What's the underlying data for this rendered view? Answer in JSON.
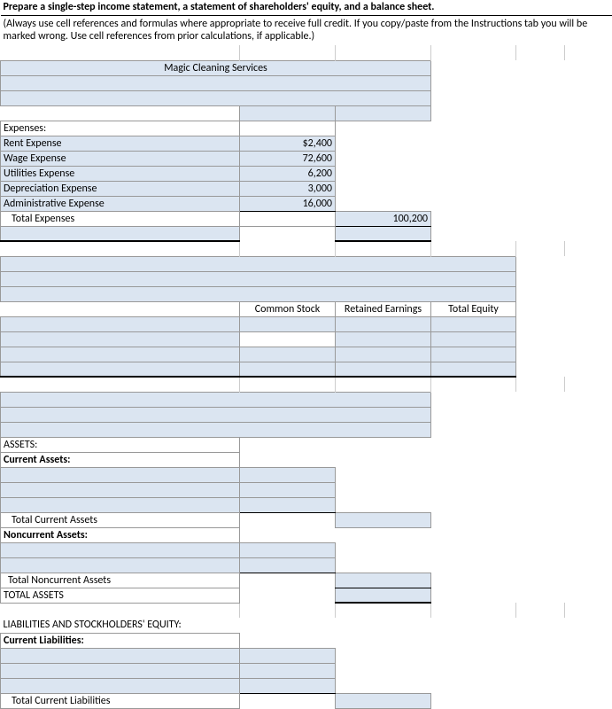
{
  "header": {
    "title": "Prepare a single-step income statement, a statement of shareholders' equity, and a balance sheet.",
    "note": "(Always use cell references and formulas where appropriate to receive full credit. If you copy/paste from the Instructions tab you will be marked wrong. Use cell references from prior calculations, if applicable.)"
  },
  "company": "Magic Cleaning Services",
  "income": {
    "section": "Expenses:",
    "items": [
      {
        "label": "Rent Expense",
        "value": "$2,400"
      },
      {
        "label": "Wage Expense",
        "value": "72,600"
      },
      {
        "label": "Utilities Expense",
        "value": "6,200"
      },
      {
        "label": "Depreciation Expense",
        "value": "3,000"
      },
      {
        "label": "Administrative Expense",
        "value": "16,000"
      }
    ],
    "total_label": "Total Expenses",
    "total_value": "100,200"
  },
  "equity": {
    "col1": "Common Stock",
    "col2": "Retained Earnings",
    "col3": "Total Equity"
  },
  "balance": {
    "assets": "ASSETS:",
    "current_assets": "Current Assets:",
    "total_current_assets": "Total Current Assets",
    "noncurrent_assets": "Noncurrent Assets:",
    "total_noncurrent_assets": "Total Noncurrent Assets",
    "total_assets": "TOTAL ASSETS",
    "liab_section": "LIABILITIES AND STOCKHOLDERS'  EQUITY:",
    "current_liab": "Current Liabilities:",
    "total_current_liab": "Total Current Liabilities"
  }
}
